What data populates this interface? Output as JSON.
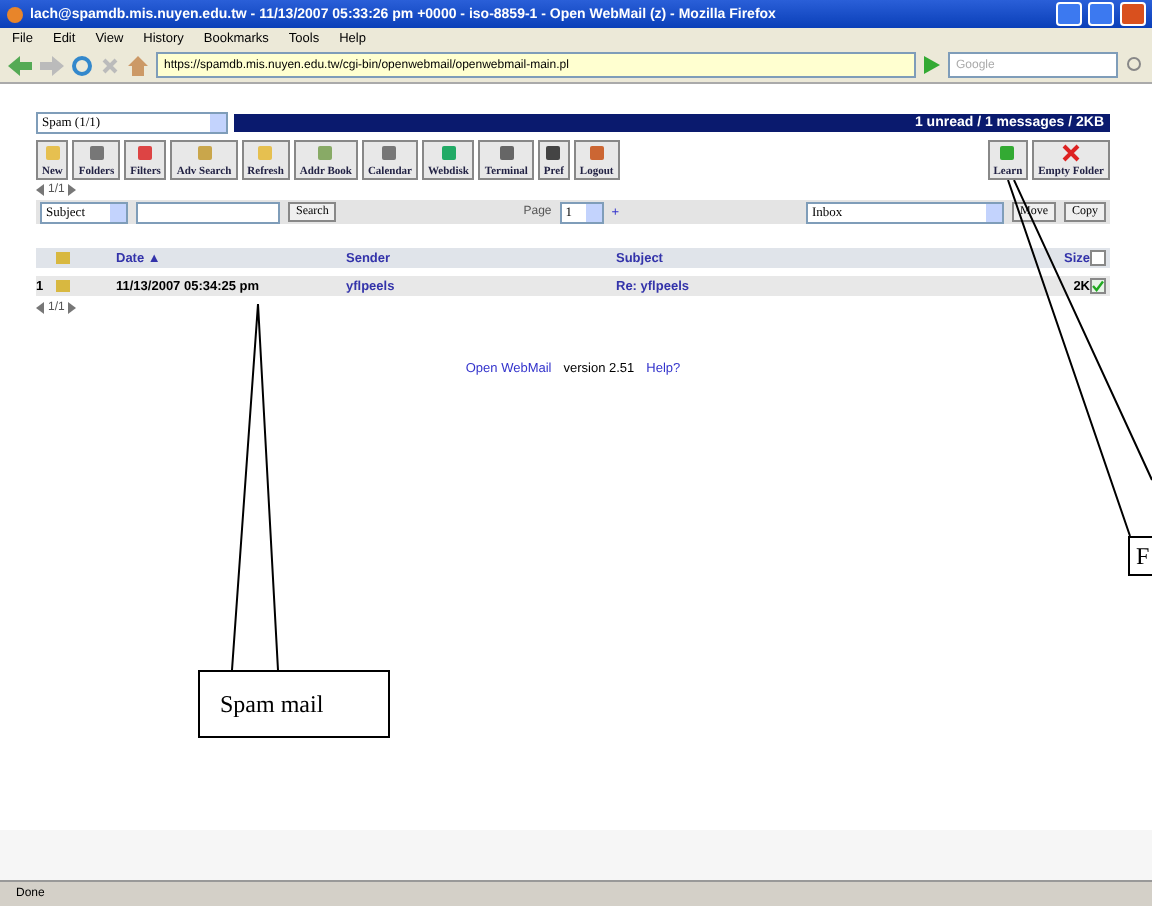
{
  "window": {
    "title": "lach@spamdb.mis.nuyen.edu.tw - 11/13/2007 05:33:26 pm +0000 - iso-8859-1 - Open WebMail (z) - Mozilla Firefox"
  },
  "menu": [
    "File",
    "Edit",
    "View",
    "History",
    "Bookmarks",
    "Tools",
    "Help"
  ],
  "address": {
    "value": "https://spamdb.mis.nuyen.edu.tw/cgi-bin/openwebmail/openwebmail-main.pl"
  },
  "search_box": {
    "placeholder": "Google"
  },
  "folder_select": {
    "value": "Spam (1/1)"
  },
  "summary": "1 unread / 1 messages / 2KB",
  "toolbar": [
    {
      "label": "New",
      "kind": "doc"
    },
    {
      "label": "Folders",
      "kind": "printer"
    },
    {
      "label": "Filters",
      "kind": "filter"
    },
    {
      "label": "Adv Search",
      "kind": "search"
    },
    {
      "label": "Refresh",
      "kind": "doc"
    },
    {
      "label": "Addr Book",
      "kind": "book"
    },
    {
      "label": "Calendar",
      "kind": "calendar"
    },
    {
      "label": "Webdisk",
      "kind": "globe"
    },
    {
      "label": "Terminal",
      "kind": "terminal"
    },
    {
      "label": "Pref",
      "kind": "gear"
    },
    {
      "label": "Logout",
      "kind": "door"
    }
  ],
  "toolbar_right": [
    {
      "label": "Learn",
      "kind": "ham"
    },
    {
      "label": "Empty Folder",
      "kind": "cross"
    }
  ],
  "pager": "1/1",
  "search_row": {
    "field": "Subject",
    "button": "Search",
    "page_label": "Page",
    "page": "1",
    "plus": "+",
    "target": "Inbox",
    "move": "Move",
    "copy": "Copy"
  },
  "table": {
    "columns": [
      "Date ▲",
      "Sender",
      "Subject",
      "Size"
    ],
    "all_checked": false,
    "rows": [
      {
        "number": "1",
        "date": "11/13/2007 05:34:25 pm",
        "sender": "yflpeels",
        "subject": "Re: yflpeels",
        "size": "2K",
        "checked": true
      }
    ]
  },
  "pager_bottom": "1/1",
  "footer": {
    "link": "Open WebMail",
    "version": "version 2.51",
    "help": "Help?"
  },
  "callouts": [
    {
      "text": "Spam mail",
      "kind": "left"
    },
    {
      "text": "F",
      "kind": "right"
    }
  ],
  "status_bar": "Done"
}
